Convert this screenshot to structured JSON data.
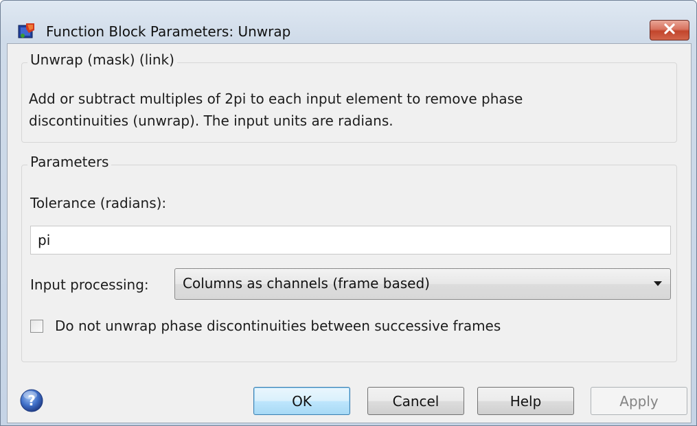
{
  "window": {
    "title": "Function Block Parameters: Unwrap",
    "app_icon": "simulink-block-icon",
    "close_icon": "close-icon"
  },
  "description_group": {
    "legend": "Unwrap (mask) (link)",
    "line1": "Add or subtract multiples of 2pi to each input element to remove phase",
    "line2": "discontinuities (unwrap). The input units are radians."
  },
  "parameters_group": {
    "legend": "Parameters",
    "tolerance_label": "Tolerance (radians):",
    "tolerance_value": "pi",
    "input_processing_label": "Input processing:",
    "input_processing_value": "Columns as channels (frame based)",
    "checkbox_label": "Do not unwrap phase discontinuities between successive frames",
    "checkbox_checked": false
  },
  "buttons": {
    "help_icon": "help-icon",
    "ok": "OK",
    "cancel": "Cancel",
    "help": "Help",
    "apply": "Apply"
  },
  "colors": {
    "close_button": "#c2452c",
    "default_button": "#3c7fb1",
    "window_frame": "#cfdbe9"
  }
}
